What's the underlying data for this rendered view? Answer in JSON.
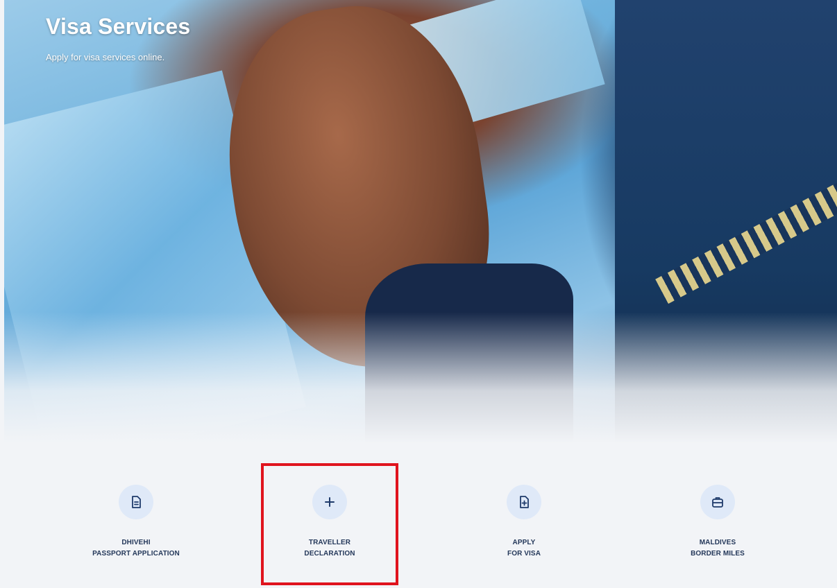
{
  "hero": {
    "title": "Visa Services",
    "subtitle": "Apply for visa services online."
  },
  "services": [
    {
      "line1": "DHIVEHI",
      "line2": "PASSPORT APPLICATION",
      "icon": "document-icon"
    },
    {
      "line1": "TRAVELLER",
      "line2": "DECLARATION",
      "icon": "plus-icon"
    },
    {
      "line1": "APPLY",
      "line2": "FOR VISA",
      "icon": "document-plus-icon"
    },
    {
      "line1": "MALDIVES",
      "line2": "BORDER MILES",
      "icon": "briefcase-icon"
    }
  ],
  "colors": {
    "accent": "#1f3b6b",
    "icon_bg": "#dfe9f8",
    "highlight": "#e0141e"
  }
}
